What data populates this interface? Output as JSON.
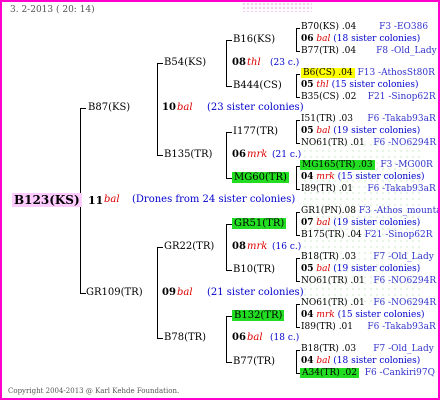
{
  "header": {
    "date": "3. 2-2013 ( 20: 14)"
  },
  "footer": {
    "copyright": "Copyright 2004-2013 @ Karl Kehde Foundation."
  },
  "root": {
    "id": "B123(KS)",
    "gen": "11",
    "year": "bal",
    "note": "(Drones from 24 sister colonies)"
  },
  "g1": [
    {
      "id": "B87(KS)",
      "gen": "10",
      "year": "bal",
      "note": "(23 sister colonies)"
    },
    {
      "id": "GR109(TR)",
      "gen": "09",
      "year": "bal",
      "note": "(21 sister colonies)"
    }
  ],
  "g2": [
    {
      "id": "B54(KS)",
      "gen": "08",
      "year": "thl",
      "note": "(23 c.)"
    },
    {
      "id": "B135(TR)",
      "gen": "06",
      "year": "mrk",
      "note": "(21 c.)"
    },
    {
      "id": "GR22(TR)",
      "gen": "08",
      "year": "mrk",
      "note": "(16 c.)"
    },
    {
      "id": "B78(TR)",
      "gen": "06",
      "year": "bal",
      "note": "(18 c.)"
    }
  ],
  "g3": [
    {
      "id": "B16(KS)",
      "gen": "06",
      "year": "bal",
      "note": "(18 sister colonies)"
    },
    {
      "id": "B444(CS)",
      "gen": "05",
      "year": "thl",
      "note": "(15 sister colonies)"
    },
    {
      "id": "I177(TR)",
      "gen": "05",
      "year": "bal",
      "note": "(19 sister colonies)"
    },
    {
      "id": "MG60(TR)",
      "gen": "04",
      "year": "mrk",
      "note": "(15 sister colonies)"
    },
    {
      "id": "GR51(TR)",
      "gen": "07",
      "year": "bal",
      "note": "(19 sister colonies)"
    },
    {
      "id": "B10(TR)",
      "gen": "05",
      "year": "bal",
      "note": "(19 sister colonies)"
    },
    {
      "id": "B132(TR)",
      "gen": "04",
      "year": "mrk",
      "note": "(15 sister colonies)"
    },
    {
      "id": "B77(TR)",
      "gen": "04",
      "year": "bal",
      "note": "(18 sister colonies)"
    }
  ],
  "g4": [
    {
      "id": "B70(KS)",
      "num": ".04",
      "link": "F3 -EO386"
    },
    {
      "id": "B77(TR)",
      "num": ".04",
      "link": "F8 -Old_Lady"
    },
    {
      "id": "B6(CS)",
      "num": ".04",
      "link": "F13 -AthosSt80R"
    },
    {
      "id": "B35(CS)",
      "num": ".02",
      "link": "F21 -Sinop62R"
    },
    {
      "id": "I51(TR)",
      "num": ".03",
      "link": "F6 -Takab93aR"
    },
    {
      "id": "NO61(TR)",
      "num": ".01",
      "link": "F6 -NO6294R"
    },
    {
      "id": "MG165(TR)",
      "num": ".03",
      "link": "F3 -MG00R"
    },
    {
      "id": "I89(TR)",
      "num": ".01",
      "link": "F6 -Takab93aR"
    },
    {
      "id": "GR1(PN)",
      "num": ".08",
      "link": "F3 -Athos_mountain06Q"
    },
    {
      "id": "B175(TR)",
      "num": ".04",
      "link": "F21 -Sinop62R"
    },
    {
      "id": "B18(TR)",
      "num": ".03",
      "link": "F7 -Old_Lady"
    },
    {
      "id": "NO61(TR)",
      "num": ".01",
      "link": "F6 -NO6294R"
    },
    {
      "id": "NO61(TR)",
      "num": ".01",
      "link": "F6 -NO6294R"
    },
    {
      "id": "I89(TR)",
      "num": ".01",
      "link": "F6 -Takab93aR"
    },
    {
      "id": "B18(TR)",
      "num": ".03",
      "link": "F7 -Old_Lady"
    },
    {
      "id": "A34(TR)",
      "num": ".02",
      "link": "F6 -Cankiri97Q"
    }
  ]
}
